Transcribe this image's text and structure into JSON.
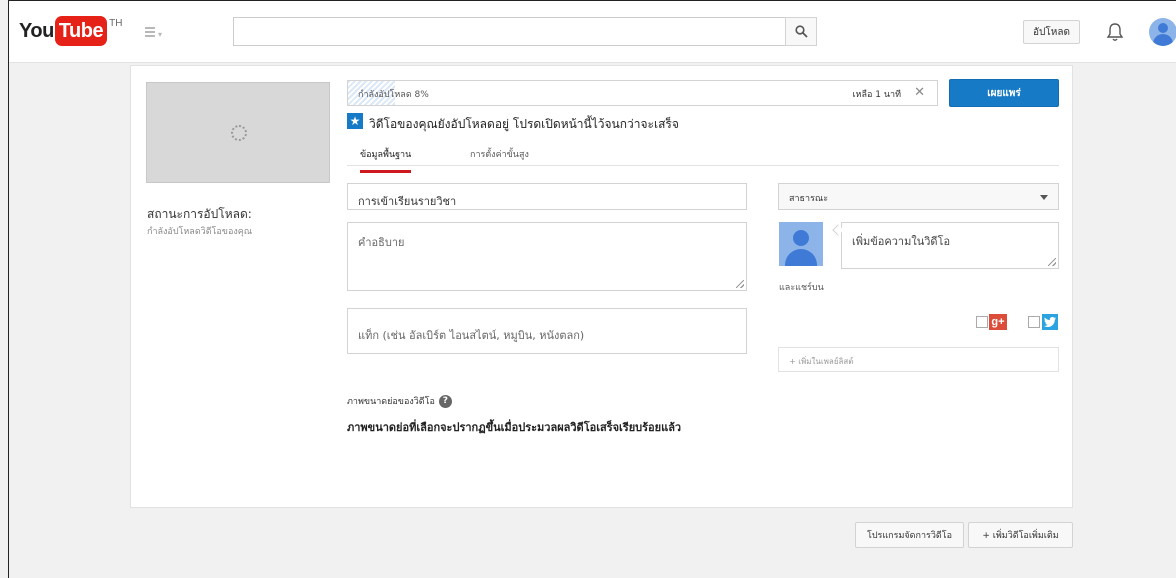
{
  "header": {
    "logo_you": "You",
    "logo_tube": "Tube",
    "country_code": "TH",
    "search_placeholder": "",
    "search_icon": "search-icon",
    "upload_label": "อัปโหลด",
    "notifications_icon": "bell-icon",
    "account_icon": "avatar-icon"
  },
  "upload": {
    "thumbnail_icon": "spinner-icon",
    "status_title": "สถานะการอัปโหลด:",
    "status_subtitle": "กำลังอัปโหลดวิดีโอของคุณ",
    "progress_label": "กำลังอัปโหลด 8%",
    "progress_fraction": 0.08,
    "time_remaining": "เหลือ 1 นาที",
    "close_icon": "close-icon",
    "publish_label": "เผยแพร่",
    "notice": "วิดีโอของคุณยังอัปโหลดอยู่ โปรดเปิดหน้านี้ไว้จนกว่าจะเสร็จ",
    "notice_icon": "star-icon"
  },
  "tabs": [
    {
      "label": "ข้อมูลพื้นฐาน",
      "active": true
    },
    {
      "label": "การตั้งค่าขั้นสูง",
      "active": false
    }
  ],
  "form": {
    "title_value": "การเข้าเรียนรายวิชา",
    "description_placeholder": "คำอธิบาย",
    "tags_placeholder": "แท็ก (เช่น อัลเบิร์ต ไอนสไตน์, หมูบิน, หนังตลก)",
    "privacy_value": "สาธารณะ",
    "share_placeholder": "เพิ่มข้อความในวิดีโอ",
    "share_label": "และแชร์บน",
    "add_to_playlist": "+ เพิ่มในเพลย์ลิสต์",
    "thumbnails_title": "ภาพขนาดย่อของวิดีโอ",
    "thumbnails_help": "?",
    "thumbnails_desc": "ภาพขนาดย่อที่เลือกจะปรากฏขึ้นเมื่อประมวลผลวิดีโอเสร็จเรียบร้อยแล้ว",
    "gplus_label": "g+",
    "twitter_icon": "twitter-icon"
  },
  "footer": {
    "video_manager": "โปรแกรมจัดการวิดีโอ",
    "add_more_videos": "+ เพิ่มวิดีโอเพิ่มเติม"
  },
  "colors": {
    "brand_red": "#e62117",
    "accent_blue": "#167ac6",
    "active_tab": "#cc181e"
  }
}
